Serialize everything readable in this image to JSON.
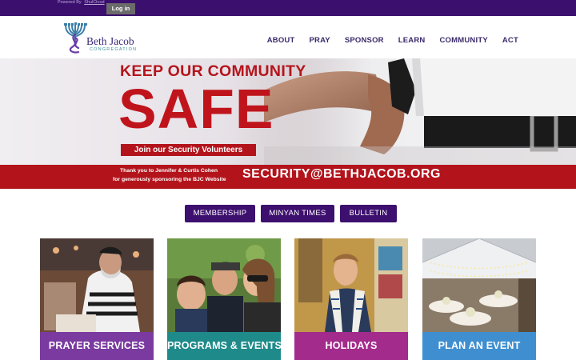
{
  "topbar": {
    "powered_by": "Powered By",
    "powered_link": "ShulCloud",
    "login_label": "Log in"
  },
  "logo": {
    "name": "Beth Jacob",
    "sub": "CONGREGATION",
    "icon": "menorah-icon"
  },
  "nav": {
    "items": [
      "ABOUT",
      "PRAY",
      "SPONSOR",
      "LEARN",
      "COMMUNITY",
      "ACT"
    ]
  },
  "hero": {
    "headline": "KEEP OUR COMMUNITY",
    "big_word": "SAFE",
    "cta": "Join our Security Volunteers",
    "thanks_line1": "Thank you to Jennifer & Curtis Cohen",
    "thanks_line2": "for generously sponsoring the BJC Website",
    "email": "SECURITY@BETHJACOB.ORG"
  },
  "buttons": {
    "membership": "MEMBERSHIP",
    "minyan": "MINYAN TIMES",
    "bulletin": "BULLETIN"
  },
  "cards": [
    {
      "label": "PRAYER SERVICES",
      "color": "#7a3aa0"
    },
    {
      "label": "PROGRAMS & EVENTS",
      "color": "#1f8a8a"
    },
    {
      "label": "HOLIDAYS",
      "color": "#a32b8c"
    },
    {
      "label": "PLAN AN EVENT",
      "color": "#3f8fd0"
    }
  ],
  "colors": {
    "brand_purple": "#3d0f6e",
    "brand_red": "#b3141c",
    "nav_text": "#3b2a6a"
  }
}
